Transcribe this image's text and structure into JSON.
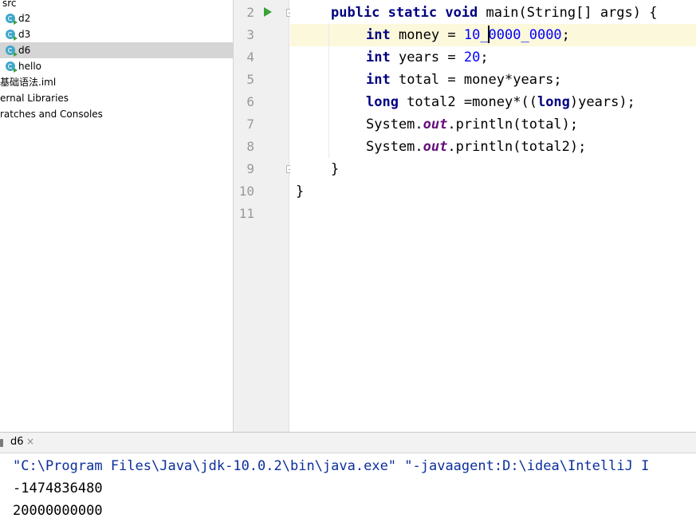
{
  "project_tree": {
    "items": [
      {
        "label": "src",
        "type": "folder",
        "selected": false
      },
      {
        "label": "d2",
        "type": "class",
        "selected": false
      },
      {
        "label": "d3",
        "type": "class",
        "selected": false
      },
      {
        "label": "d6",
        "type": "class",
        "selected": true
      },
      {
        "label": "hello",
        "type": "class",
        "selected": false
      },
      {
        "label": "基础语法.iml",
        "type": "file",
        "selected": false
      },
      {
        "label": "ernal Libraries",
        "type": "library",
        "selected": false
      },
      {
        "label": "ratches and Consoles",
        "type": "scratch",
        "selected": false
      }
    ]
  },
  "editor": {
    "line_numbers": [
      "2",
      "3",
      "4",
      "5",
      "6",
      "7",
      "8",
      "9",
      "10",
      "11"
    ],
    "current_line": "3",
    "code": {
      "l2": {
        "kw1": "public",
        "kw2": "static",
        "kw3": "void",
        "rest": " main(String[] args) {"
      },
      "l3": {
        "kw": "int",
        "pre": " money = ",
        "num": "10_0000_0000",
        "post": ";"
      },
      "l4": {
        "kw": "int",
        "pre": " years = ",
        "num": "20",
        "post": ";"
      },
      "l5": {
        "kw": "int",
        "rest": " total = money*years;"
      },
      "l6": {
        "kw1": "long",
        "mid": " total2 =money*((",
        "kw2": "long",
        "post": ")years);"
      },
      "l7": {
        "pre": "System.",
        "field": "out",
        "post": ".println(total);"
      },
      "l8": {
        "pre": "System.",
        "field": "out",
        "post": ".println(total2);"
      },
      "l9": {
        "text": "}"
      },
      "l10": {
        "text": "}"
      }
    }
  },
  "run_panel": {
    "tab_label": "d6",
    "close_glyph": "×",
    "console_lines": [
      {
        "text": "\"C:\\Program Files\\Java\\jdk-10.0.2\\bin\\java.exe\" \"-javaagent:D:\\idea\\IntelliJ I",
        "color": "#0b2e9c"
      },
      {
        "text": "-1474836480",
        "color": "#000000"
      },
      {
        "text": "20000000000",
        "color": "#000000"
      }
    ]
  },
  "colors": {
    "keyword": "#000080",
    "number": "#0000ff",
    "static_field": "#660e7a",
    "current_line_bg": "#fcf8dc",
    "selection_bg": "#d5d5d5",
    "run_icon": "#3aa23a"
  }
}
